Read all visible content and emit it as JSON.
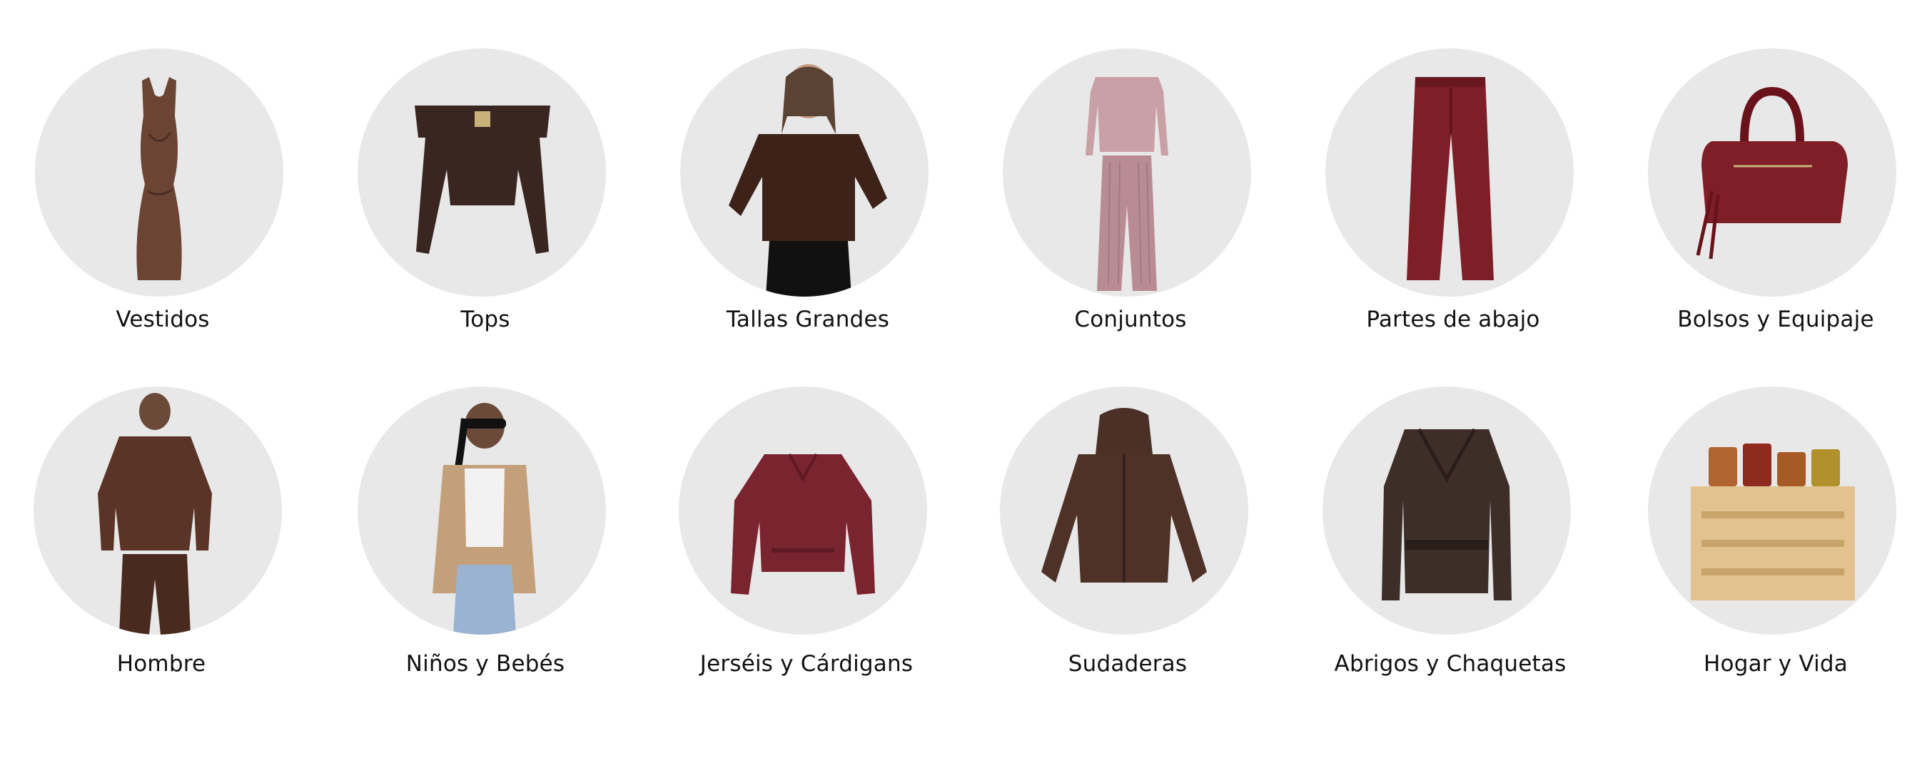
{
  "categories": {
    "row1": [
      {
        "label": "Vestidos",
        "icon": "dress-icon"
      },
      {
        "label": "Tops",
        "icon": "off-shoulder-top-icon"
      },
      {
        "label": "Tallas Grandes",
        "icon": "plus-size-model-icon"
      },
      {
        "label": "Conjuntos",
        "icon": "two-piece-set-icon"
      },
      {
        "label": "Partes de abajo",
        "icon": "trousers-icon"
      },
      {
        "label": "Bolsos y Equipaje",
        "icon": "handbag-icon"
      }
    ],
    "row2": [
      {
        "label": "Hombre",
        "icon": "menswear-model-icon"
      },
      {
        "label": "Niños y Bebés",
        "icon": "kids-model-icon"
      },
      {
        "label": "Jerséis y Cárdigans",
        "icon": "sweater-icon"
      },
      {
        "label": "Sudaderas",
        "icon": "hoodie-icon"
      },
      {
        "label": "Abrigos y Chaquetas",
        "icon": "leather-jacket-icon"
      },
      {
        "label": "Hogar y Vida",
        "icon": "kitchen-rack-icon"
      }
    ]
  },
  "colors": {
    "circle_bg": "#e8e8e8",
    "brown": "#6b4434",
    "dark_brown": "#3a2620",
    "wine": "#7e1e27",
    "pink": "#c9a0a6",
    "knit_red": "#7a2430",
    "wood": "#e2c28f"
  }
}
